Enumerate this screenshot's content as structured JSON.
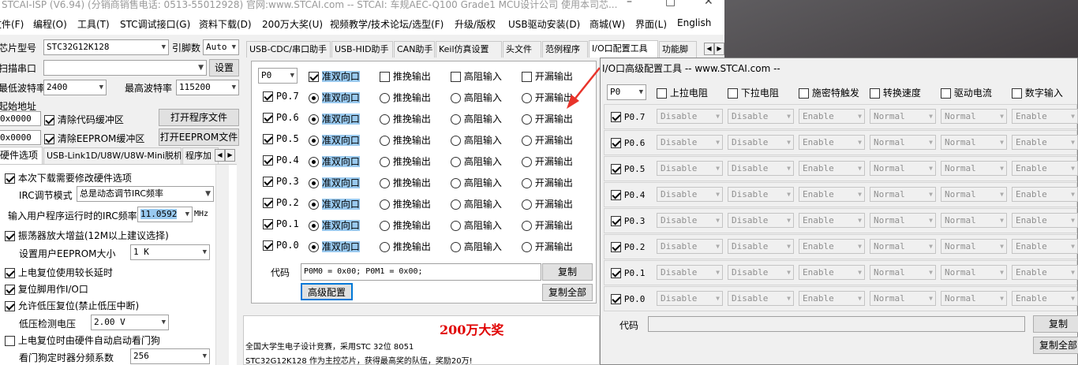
{
  "window": {
    "title": "STCAI-ISP (V6.94) (分销商销售电话: 0513-55012928) 官网:www.STCAI.com  -- STCAI: 车规AEC-Q100 Grade1 MCU设计公司 使用本司芯...",
    "controls": [
      "–",
      "□",
      "✕"
    ]
  },
  "menu": [
    "文件(F)",
    "编程(O)",
    "工具(T)",
    "STC调试接口(G)",
    "资料下载(D)",
    "200万大奖(U)",
    "视频教学/技术论坛/选型(F)",
    "升级/版权",
    "USB驱动安装(D)",
    "商城(W)",
    "界面(L)",
    "English"
  ],
  "left": {
    "chip_label": "芯片型号",
    "chip_value": "STC32G12K128",
    "pin_label": "引脚数",
    "pin_value": "Auto",
    "scan_label": "扫描串口",
    "scan_value": "",
    "set_button": "设置",
    "min_baud_label": "最低波特率",
    "min_baud_value": "2400",
    "max_baud_label": "最高波特率",
    "max_baud_value": "115200",
    "start_addr_label": "起始地址",
    "addr1": "0x0000",
    "clear_code": "清除代码缓冲区",
    "open_program": "打开程序文件",
    "addr2": "0x0000",
    "clear_eeprom": "清除EEPROM缓冲区",
    "open_eeprom": "打开EEPROM文件",
    "tabs": [
      "硬件选项",
      "USB-Link1D/U8W/U8W-Mini脱机",
      "程序加"
    ],
    "options": {
      "need_modify": "本次下载需要修改硬件选项",
      "irc_mode_label": "IRC调节模式",
      "irc_mode_value": "总是动态调节IRC频率",
      "irc_freq_label": "输入用户程序运行时的IRC频率",
      "irc_freq_value": "11.0592",
      "irc_freq_unit": "MHz",
      "osc_gain": "振荡器放大增益(12M以上建议选择)",
      "eeprom_size_label": "设置用户EEPROM大小",
      "eeprom_size_value": "1    K",
      "por_delay": "上电复位使用较长延时",
      "reset_pin_io": "复位脚用作I/O口",
      "lvd_reset": "允许低压复位(禁止低压中断)",
      "lvd_voltage_label": "低压检测电压",
      "lvd_voltage_value": "2.00 V",
      "wdt_auto": "上电复位时由硬件自动启动看门狗",
      "wdt_div_label": "看门狗定时器分频系数",
      "wdt_div_value": "256"
    }
  },
  "middle": {
    "tabs": [
      "USB-CDC/串口助手",
      "USB-HID助手",
      "CAN助手",
      "Keil仿真设置",
      "头文件",
      "范例程序",
      "I/O口配置工具",
      "功能脚"
    ],
    "port_select": "P0",
    "modes": [
      "准双向口",
      "推挽输出",
      "高阻输入",
      "开漏输出"
    ],
    "pins": [
      "P0.7",
      "P0.6",
      "P0.5",
      "P0.4",
      "P0.3",
      "P0.2",
      "P0.1",
      "P0.0"
    ],
    "code_label": "代码",
    "code_value": "P0M0 = 0x00; P0M1 = 0x00;",
    "copy_button": "复制",
    "advanced_button": "高级配置",
    "copy_all_button": "复制全部",
    "ad_title": "200万大奖",
    "ad_line1": "全国大学生电子设计竞赛，采用STC 32位 8051",
    "ad_line2": "STC32G12K128 作为主控芯片，获得最高奖的队伍，奖励20万!"
  },
  "advanced": {
    "title": "I/O口高级配置工具 -- www.STCAI.com --",
    "port_select": "P0",
    "headers": [
      "上拉电阻",
      "下拉电阻",
      "施密特触发",
      "转换速度",
      "驱动电流",
      "数字输入"
    ],
    "pins": [
      "P0.7",
      "P0.6",
      "P0.5",
      "P0.4",
      "P0.3",
      "P0.2",
      "P0.1",
      "P0.0"
    ],
    "values": [
      "Disable",
      "Disable",
      "Enable",
      "Normal",
      "Normal",
      "Enable"
    ],
    "code_label": "代码",
    "code_value": "",
    "copy_button": "复制",
    "copy_all_button": "复制全部"
  }
}
